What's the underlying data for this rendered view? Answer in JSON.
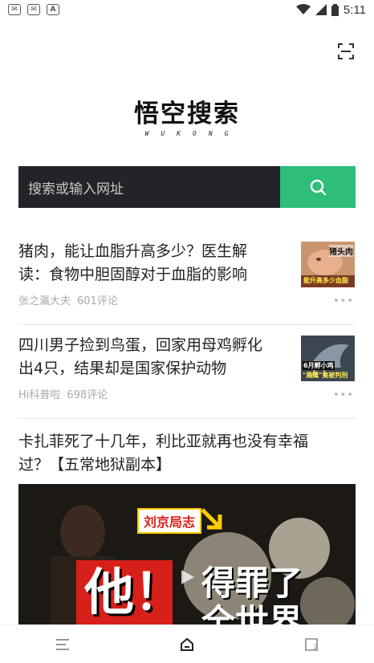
{
  "status_bar": {
    "time": "5:11",
    "icon_a": "A"
  },
  "logo": {
    "title": "悟空搜索",
    "subtitle": "WUKONG"
  },
  "search": {
    "placeholder": "搜索或输入网址"
  },
  "feed": [
    {
      "title": "猪肉，能让血脂升高多少？医生解读：食物中胆固醇对于血脂的影响",
      "source": "张之瀛大夫",
      "comments": "601评论",
      "thumb_text_top": "猪头肉",
      "thumb_text_bottom": "能升高多少血脂"
    },
    {
      "title": "四川男子捡到鸟蛋，回家用母鸡孵化出4只，结果却是国家保护动物",
      "source": "Hi科普啦",
      "comments": "698评论",
      "thumb_text_top": "6月孵小鸡",
      "thumb_text_bottom": "\"黑鹰\"竟被判刑"
    }
  ],
  "feature": {
    "title": "卡扎菲死了十几年，利比亚就再也没有幸福过？【五常地狱副本】",
    "cover_badge": "刘京局志",
    "cover_big_char": "他！",
    "cover_text_1": "得罪了",
    "cover_text_2": "全世界"
  },
  "bottom_nav": {
    "tab_count": "2"
  },
  "colors": {
    "accent": "#2ebd7a",
    "search_bg": "#222428"
  }
}
